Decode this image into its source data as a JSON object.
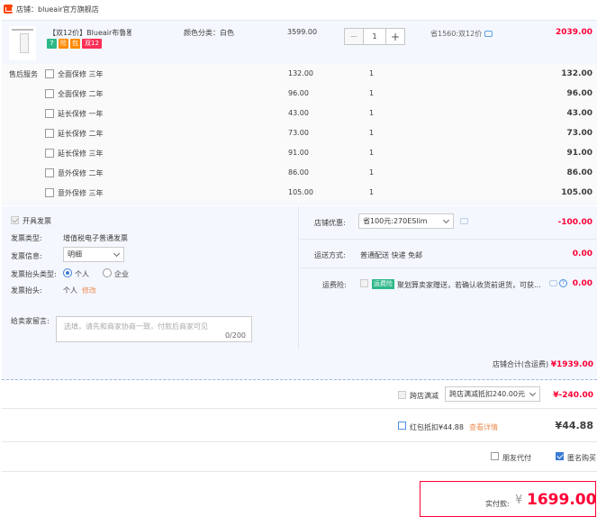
{
  "shop": {
    "label": "店铺：blueair官方旗舰店"
  },
  "product": {
    "title": "【双12价】Blueair布鲁雅尔空...",
    "badges": [
      "7",
      "险",
      "包",
      "双12"
    ],
    "sku": "颜色分类：白色",
    "price": "3599.00",
    "qty": "1",
    "qty_minus": "−",
    "qty_plus": "+",
    "save_text": "省1560:双12价",
    "total": "2039.00"
  },
  "services": {
    "header": "售后服务",
    "items": [
      {
        "label": "全面保修 三年",
        "price": "132.00",
        "qty": "1",
        "total": "132.00"
      },
      {
        "label": "全面保修 二年",
        "price": "96.00",
        "qty": "1",
        "total": "96.00"
      },
      {
        "label": "延长保修 一年",
        "price": "43.00",
        "qty": "1",
        "total": "43.00"
      },
      {
        "label": "延长保修 二年",
        "price": "73.00",
        "qty": "1",
        "total": "73.00"
      },
      {
        "label": "延长保修 三年",
        "price": "91.00",
        "qty": "1",
        "total": "91.00"
      },
      {
        "label": "意外保修 二年",
        "price": "86.00",
        "qty": "1",
        "total": "86.00"
      },
      {
        "label": "意外保修 三年",
        "price": "105.00",
        "qty": "1",
        "total": "105.00"
      }
    ]
  },
  "invoice": {
    "open_label": "开具发票",
    "type_label": "发票类型:",
    "type_value": "增值税电子普通发票",
    "info_label": "发票信息:",
    "info_value": "明细",
    "title_type_label": "发票抬头类型:",
    "opt_personal": "个人",
    "opt_company": "企业",
    "title_label": "发票抬头:",
    "title_value": "个人",
    "edit_link": "修改"
  },
  "message": {
    "label": "给卖家留言:",
    "placeholder": "选填，请先和商家协商一致，付款后商家可见",
    "counter": "0/200"
  },
  "discount": {
    "label": "店铺优惠:",
    "select_value": "省100元:270ESlim",
    "amount": "-100.00"
  },
  "shipping": {
    "label": "运送方式:",
    "value": "普通配送 快递 免邮",
    "amount": "0.00"
  },
  "insurance": {
    "label": "运费险:",
    "tag": "运费险",
    "text": "聚划算卖家赠送，若确认收货前退货，可获...",
    "help": "?",
    "amount": "0.00"
  },
  "subtotal": {
    "label": "店铺合计(含运费)",
    "amount": "¥1939.00"
  },
  "cross_store": {
    "label": "跨店满减",
    "select_value": "跨店满减抵扣240.00元",
    "amount": "¥-240.00"
  },
  "red_packet": {
    "label": "红包抵扣¥44.88",
    "details_link": "查看详情",
    "amount": "¥44.88"
  },
  "options": {
    "friend_pay": "朋友代付",
    "anonymous": "匿名购买"
  },
  "payment": {
    "label": "实付款:",
    "currency": "¥",
    "amount": "1699.00"
  },
  "colors": {
    "price_red": "#ff0036",
    "panel_bg": "#f4f7fd",
    "accent_blue": "#3a7bd5",
    "tag_green": "#2eb888"
  }
}
